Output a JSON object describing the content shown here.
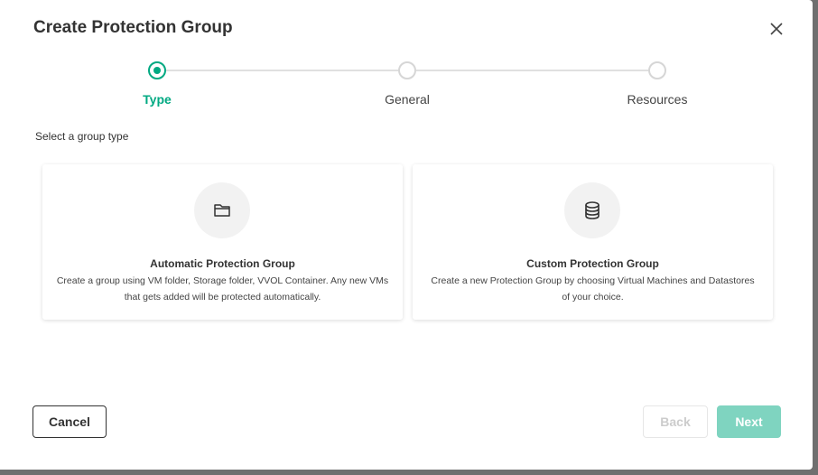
{
  "dialog": {
    "title": "Create Protection Group",
    "close_label": "Close"
  },
  "stepper": {
    "steps": [
      {
        "label": "Type",
        "state": "active"
      },
      {
        "label": "General",
        "state": "pending"
      },
      {
        "label": "Resources",
        "state": "pending"
      }
    ],
    "accent_color": "#01a982"
  },
  "prompt": "Select a group type",
  "cards": [
    {
      "icon": "folder-icon",
      "title": "Automatic Protection Group",
      "description": "Create a group using VM folder, Storage folder, VVOL Container. Any new VMs that gets added will be protected automatically."
    },
    {
      "icon": "database-icon",
      "title": "Custom Protection Group",
      "description": "Create a new Protection Group by choosing Virtual Machines and Datastores of your choice."
    }
  ],
  "footer": {
    "cancel_label": "Cancel",
    "back_label": "Back",
    "next_label": "Next",
    "back_disabled": true,
    "next_disabled": true
  }
}
